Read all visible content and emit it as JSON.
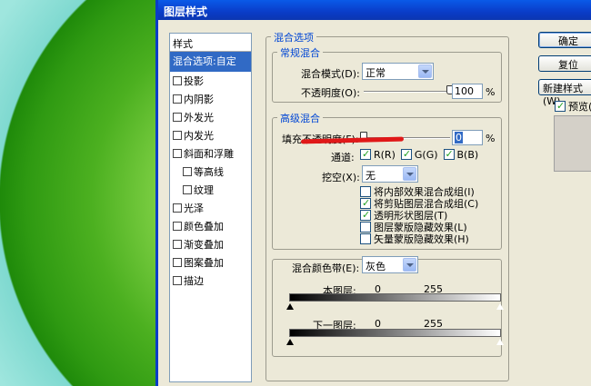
{
  "window": {
    "title": "图层样式"
  },
  "styles_list": {
    "header": "样式",
    "items": [
      {
        "label": "混合选项:自定",
        "checkbox": false,
        "selected": true,
        "indent": false
      },
      {
        "label": "投影",
        "checkbox": true,
        "checked": false,
        "indent": false
      },
      {
        "label": "内阴影",
        "checkbox": true,
        "checked": false,
        "indent": false
      },
      {
        "label": "外发光",
        "checkbox": true,
        "checked": false,
        "indent": false
      },
      {
        "label": "内发光",
        "checkbox": true,
        "checked": false,
        "indent": false
      },
      {
        "label": "斜面和浮雕",
        "checkbox": true,
        "checked": false,
        "indent": false
      },
      {
        "label": "等高线",
        "checkbox": true,
        "checked": false,
        "indent": true
      },
      {
        "label": "纹理",
        "checkbox": true,
        "checked": false,
        "indent": true
      },
      {
        "label": "光泽",
        "checkbox": true,
        "checked": false,
        "indent": false
      },
      {
        "label": "颜色叠加",
        "checkbox": true,
        "checked": false,
        "indent": false
      },
      {
        "label": "渐变叠加",
        "checkbox": true,
        "checked": false,
        "indent": false
      },
      {
        "label": "图案叠加",
        "checkbox": true,
        "checked": false,
        "indent": false
      },
      {
        "label": "描边",
        "checkbox": true,
        "checked": false,
        "indent": false
      }
    ]
  },
  "blending_options": {
    "title": "混合选项",
    "general": {
      "title": "常规混合",
      "blend_mode_label": "混合模式(D):",
      "blend_mode_value": "正常",
      "opacity_label": "不透明度(O):",
      "opacity_value": "100",
      "opacity_unit": "%",
      "opacity_level": 1.0
    },
    "advanced": {
      "title": "高级混合",
      "fill_opacity_label": "填充不透明度(F):",
      "fill_opacity_value": "0",
      "fill_opacity_unit": "%",
      "fill_opacity_level": 0.0,
      "channels_label": "通道:",
      "channels": [
        {
          "label": "R(R)",
          "checked": true
        },
        {
          "label": "G(G)",
          "checked": true
        },
        {
          "label": "B(B)",
          "checked": true
        }
      ],
      "knockout_label": "挖空(X):",
      "knockout_value": "无",
      "options": [
        {
          "label": "将内部效果混合成组(I)",
          "checked": false
        },
        {
          "label": "将剪贴图层混合成组(C)",
          "checked": true
        },
        {
          "label": "透明形状图层(T)",
          "checked": true
        },
        {
          "label": "图层蒙版隐藏效果(L)",
          "checked": false
        },
        {
          "label": "矢量蒙版隐藏效果(H)",
          "checked": false
        }
      ]
    },
    "blend_if": {
      "label": "混合颜色带(E):",
      "value": "灰色",
      "this_layer_label": "本图层:",
      "this_layer_low": "0",
      "this_layer_high": "255",
      "underlying_label": "下一图层:",
      "underlying_low": "0",
      "underlying_high": "255"
    }
  },
  "buttons": {
    "ok": "确定",
    "reset": "复位",
    "new_style": "新建样式(W)",
    "preview": "预览(V)",
    "preview_checked": true
  },
  "colors": {
    "title_bar": "#0a3cc8",
    "selection": "#316ac5",
    "group_title": "#0046d5",
    "annotation_red": "#e01818"
  }
}
